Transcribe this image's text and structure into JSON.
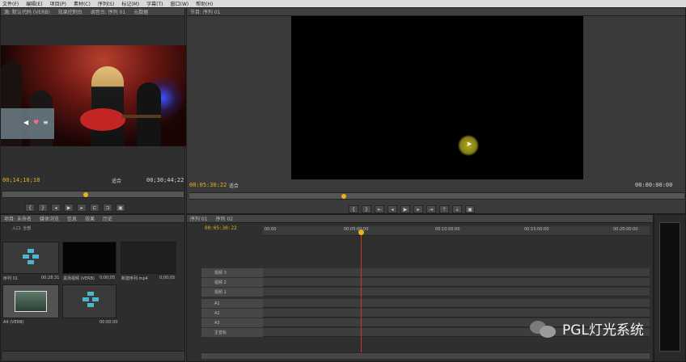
{
  "menubar": {
    "items": [
      "文件(F)",
      "编辑(E)",
      "项目(P)",
      "素材(C)",
      "序列(S)",
      "标记(M)",
      "字幕(T)",
      "窗口(W)",
      "帮助(H)"
    ]
  },
  "source": {
    "tabs": [
      "源: 默认代码 (VERB)",
      "效果控制台",
      "调音台: 序列 01",
      "元数据"
    ],
    "timecode_current": "00;14;10;18",
    "timecode_duration": "00;30;44;22",
    "fit": "适合"
  },
  "program": {
    "tab": "节目: 序列 01",
    "timecode_current": "00:05:30:22",
    "timecode_duration": "00:00:00:00",
    "fit": "适合"
  },
  "project": {
    "tabs": [
      "项目: 未命名",
      "媒体浏览",
      "信息",
      "效果",
      "历史"
    ],
    "search_label": "入口: 全部",
    "items": [
      {
        "name": "序列 01",
        "duration": "00;28;31"
      },
      {
        "name": "黑场视频 (VERB)",
        "duration": "0;00;05"
      },
      {
        "name": "新建序列.mp4",
        "duration": "0;00;05"
      },
      {
        "name": "A4 (VERB)",
        "duration": "00;30;44;22"
      },
      {
        "name": "序列 01",
        "duration": "00;00;00"
      }
    ]
  },
  "timeline": {
    "tabs": [
      "序列 01",
      "序列 02"
    ],
    "timecode": "00:05:30:22",
    "ruler_labels": [
      "00:00",
      "00:05:00:00",
      "00:10:00:00",
      "00:15:00:00",
      "00:20:00:00"
    ],
    "tracks": [
      "视频 3",
      "视频 2",
      "视频 1",
      "A1",
      "A2",
      "A3",
      "主音轨"
    ]
  },
  "watermark": {
    "text": "PGL灯光系统"
  }
}
